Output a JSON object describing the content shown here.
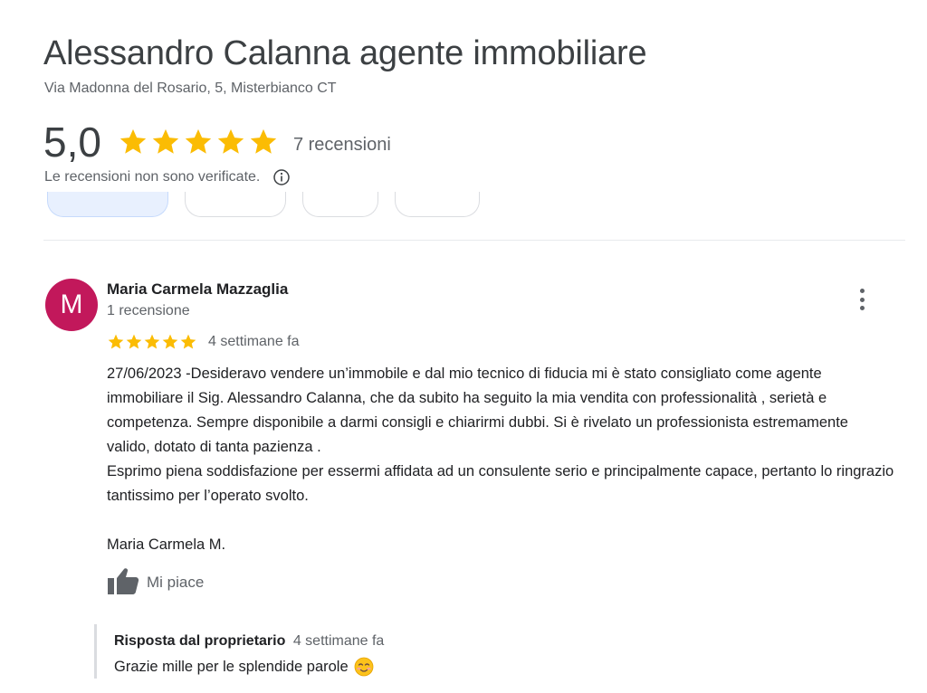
{
  "place": {
    "name": "Alessandro Calanna agente immobiliare",
    "address": "Via Madonna del Rosario, 5, Misterbianco CT"
  },
  "rating": {
    "value": "5,0",
    "stars": 5,
    "max_stars": 5,
    "count_label": "7 recensioni",
    "star_color": "#fbbc04",
    "not_verified_text": "Le recensioni non sono verificate.",
    "info_icon": "info-icon"
  },
  "review": {
    "avatar_letter": "M",
    "avatar_color": "#c2185b",
    "author": "Maria Carmela Mazzaglia",
    "author_reviews": "1 recensione",
    "stars": 5,
    "date": "4 settimane fa",
    "text": "27/06/2023 -Desideravo vendere un’immobile e dal mio tecnico di fiducia mi è stato consigliato come agente immobiliare il Sig. Alessandro Calanna, che da subito ha seguito la mia vendita con professionalità , serietà e competenza. Sempre disponibile a darmi consigli e chiarirmi dubbi. Si è rivelato un professionista estremamente valido, dotato di tanta pazienza .\nEsprimo piena soddisfazione per essermi affidata ad un consulente serio e principalmente capace, pertanto  lo ringrazio tantissimo per l’operato svolto.\n\nMaria Carmela M.",
    "like_label": "Mi piace",
    "like_icon": "thumbs-up-icon",
    "more_icon": "more-vert-icon"
  },
  "owner_reply": {
    "label": "Risposta dal proprietario",
    "date": "4 settimane fa",
    "text": "Grazie mille per le splendide parole",
    "emoji_icon": "smiling-face-icon"
  }
}
